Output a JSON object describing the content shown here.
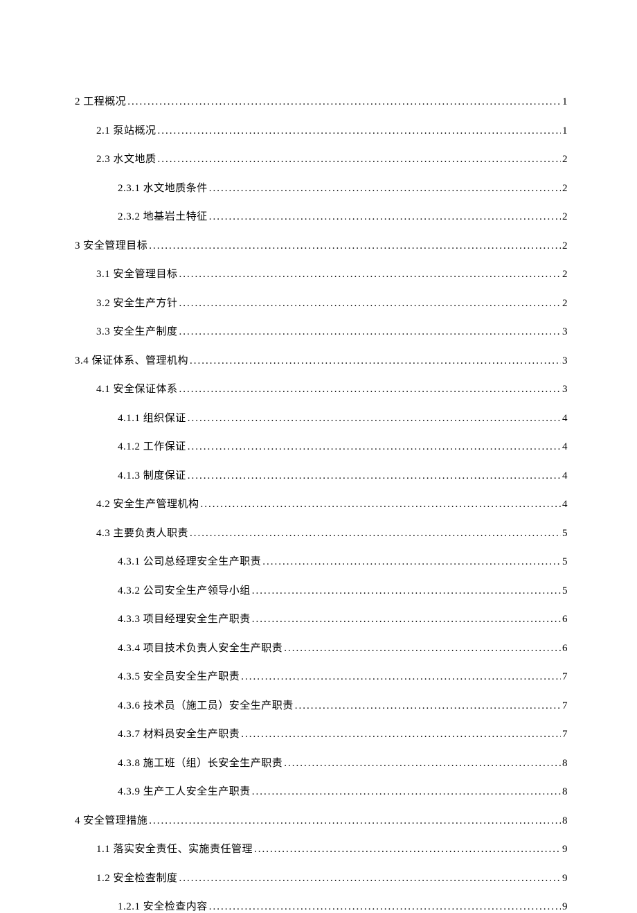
{
  "toc": [
    {
      "level": "level-0",
      "label": "2 工程概况",
      "page": "1"
    },
    {
      "level": "level-1",
      "label": "2.1  泵站概况",
      "page": "1"
    },
    {
      "level": "level-1",
      "label": "2.3  水文地质",
      "page": "2"
    },
    {
      "level": "level-2",
      "label": "2.3.1  水文地质条件",
      "page": "2"
    },
    {
      "level": "level-2",
      "label": "2.3.2  地基岩土特征",
      "page": "2"
    },
    {
      "level": "level-0",
      "label": "3 安全管理目标",
      "page": "2"
    },
    {
      "level": "level-1",
      "label": "3.1  安全管理目标",
      "page": "2"
    },
    {
      "level": "level-1",
      "label": "3.2  安全生产方针",
      "page": "2"
    },
    {
      "level": "level-1",
      "label": "3.3  安全生产制度",
      "page": "3"
    },
    {
      "level": "special-34",
      "label": "3.4      保证体系、管理机构",
      "page": "3"
    },
    {
      "level": "level-1",
      "label": "4.1  安全保证体系",
      "page": "3"
    },
    {
      "level": "level-2",
      "label": "4.1.1  组织保证",
      "page": "4"
    },
    {
      "level": "level-2",
      "label": "4.1.2  工作保证",
      "page": "4"
    },
    {
      "level": "level-2",
      "label": "4.1.3  制度保证",
      "page": "4"
    },
    {
      "level": "level-1",
      "label": "4.2  安全生产管理机构",
      "page": "4"
    },
    {
      "level": "level-1",
      "label": "4.3  主要负责人职责",
      "page": "5"
    },
    {
      "level": "level-2",
      "label": "4.3.1  公司总经理安全生产职责",
      "page": "5"
    },
    {
      "level": "level-2",
      "label": "4.3.2  公司安全生产领导小组",
      "page": "5"
    },
    {
      "level": "level-2",
      "label": "4.3.3  项目经理安全生产职责",
      "page": "6"
    },
    {
      "level": "level-2",
      "label": "4.3.4  项目技术负责人安全生产职责",
      "page": "6"
    },
    {
      "level": "level-2",
      "label": "4.3.5  安全员安全生产职责",
      "page": "7"
    },
    {
      "level": "level-2",
      "label": "4.3.6  技术员（施工员）安全生产职责",
      "page": "7"
    },
    {
      "level": "level-2",
      "label": "4.3.7  材料员安全生产职责",
      "page": "7"
    },
    {
      "level": "level-2",
      "label": "4.3.8  施工班（组）长安全生产职责",
      "page": "8"
    },
    {
      "level": "level-2",
      "label": "4.3.9  生产工人安全生产职责",
      "page": "8"
    },
    {
      "level": "level-0",
      "label": "4 安全管理措施",
      "page": "8"
    },
    {
      "level": "level-1",
      "label": "1.1   落实安全责任、实施责任管理",
      "page": "9"
    },
    {
      "level": "level-1",
      "label": "1.2   安全检查制度",
      "page": "9"
    },
    {
      "level": "level-2",
      "label": "1.2.1  安全检查内容",
      "page": "9"
    }
  ],
  "dots": "........................................................................................................................................................"
}
